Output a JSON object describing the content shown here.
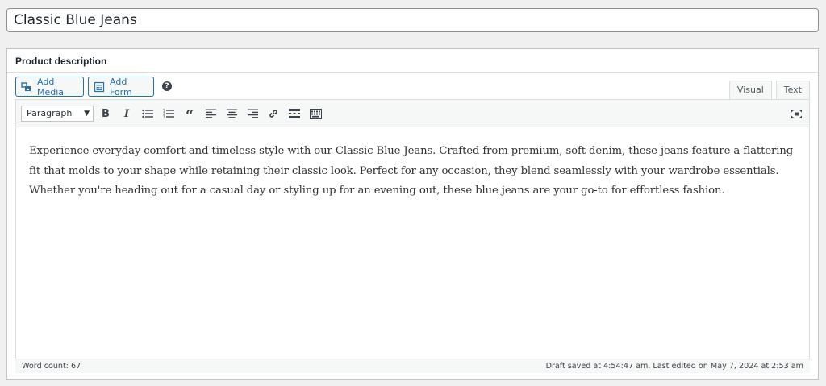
{
  "title": {
    "value": "Classic Blue Jeans"
  },
  "postbox": {
    "heading": "Product description"
  },
  "media_buttons": {
    "add_media": "Add Media",
    "add_form": "Add Form",
    "help": "?"
  },
  "editor_tabs": {
    "visual": "Visual",
    "text": "Text"
  },
  "toolbar": {
    "format": "Paragraph",
    "bold": "B",
    "italic": "I",
    "icons": [
      "bulleted-list",
      "numbered-list",
      "blockquote",
      "align-left",
      "align-center",
      "align-right",
      "insert-link",
      "read-more",
      "toolbar-toggle",
      "fullscreen"
    ]
  },
  "content": {
    "text": "Experience everyday comfort and timeless style with our Classic Blue Jeans. Crafted from premium, soft denim, these jeans feature a flattering fit that molds to your shape while retaining their classic look. Perfect for any occasion, they blend seamlessly with your wardrobe essentials. Whether you're heading out for a casual day or styling up for an evening out, these blue jeans are your go-to for effortless fashion."
  },
  "status": {
    "word_count": "Word count: 67",
    "saved": "Draft saved at 4:54:47 am. Last edited on May 7, 2024 at 2:53 am"
  }
}
